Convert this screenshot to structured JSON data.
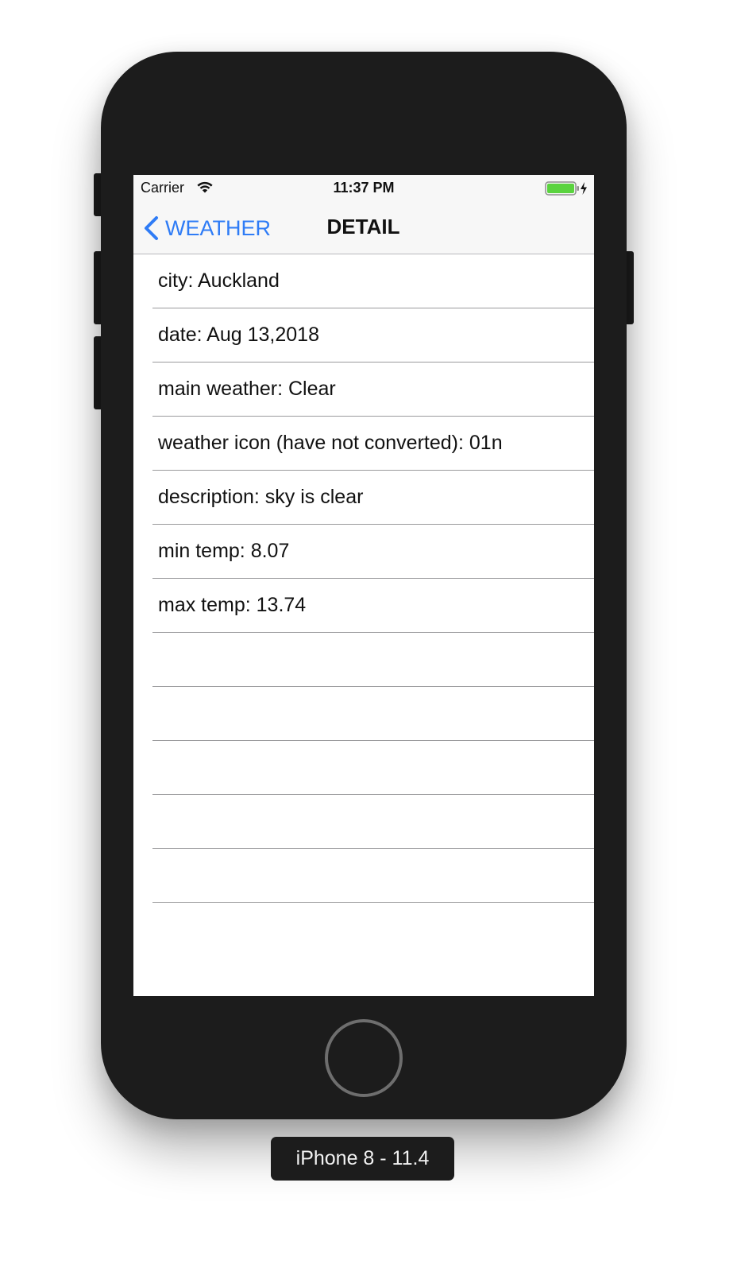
{
  "status_bar": {
    "carrier": "Carrier",
    "time": "11:37 PM",
    "wifi_icon": "wifi-icon",
    "battery_icon": "battery-charging-icon",
    "battery_level": 1.0,
    "battery_color": "#5ad33f"
  },
  "nav": {
    "back_label": "WEATHER",
    "back_icon": "chevron-left-icon",
    "title": "DETAIL",
    "accent_color": "#2f7cf6"
  },
  "rows": [
    "city: Auckland",
    "date: Aug 13,2018",
    "main weather: Clear",
    "weather icon (have not converted): 01n",
    "description: sky is clear",
    "min temp: 8.07",
    "max temp: 13.74",
    "",
    "",
    "",
    "",
    ""
  ],
  "device": {
    "label": "iPhone 8 - 11.4",
    "home_button_icon": "home-button"
  }
}
